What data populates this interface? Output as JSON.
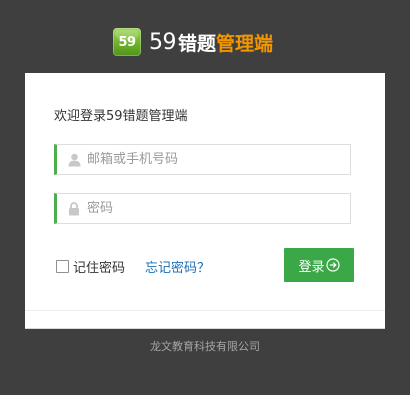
{
  "brand": {
    "logo_text": "59",
    "number": "59",
    "name_white": "错题",
    "name_orange": "管理端",
    "orange_color": "#f29600"
  },
  "login": {
    "welcome": "欢迎登录59错题管理端",
    "username_placeholder": "邮箱或手机号码",
    "username_icon": "user-icon",
    "password_placeholder": "密码",
    "password_icon": "lock-icon",
    "remember_label": "记住密码",
    "remember_checked": false,
    "forgot_label": "忘记密码？",
    "submit_label": "登录",
    "submit_icon": "arrow-circle-right-icon",
    "accent_color": "#3aa847"
  },
  "footer": {
    "company": "龙文教育科技有限公司"
  }
}
